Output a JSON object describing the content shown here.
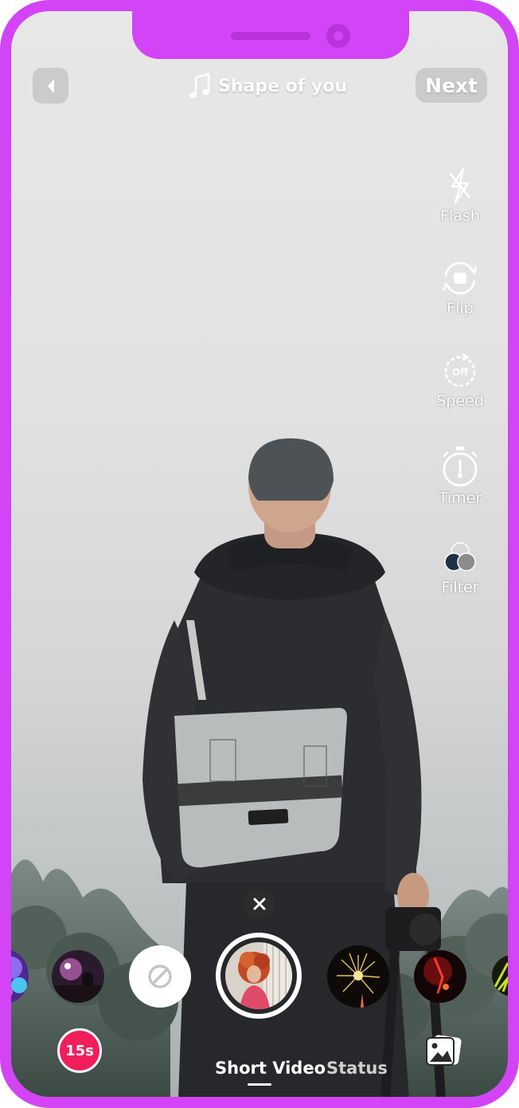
{
  "header": {
    "song_title": "Shape of you",
    "next_label": "Next"
  },
  "tools": [
    {
      "label": "Flash",
      "icon": "flash-off-icon"
    },
    {
      "label": "Flip",
      "icon": "flip-camera-icon"
    },
    {
      "label": "Speed",
      "icon": "speed-icon",
      "icon_text": "Off"
    },
    {
      "label": "Timer",
      "icon": "timer-icon"
    },
    {
      "label": "Filter",
      "icon": "filter-icon"
    }
  ],
  "bottom": {
    "duration": "15s",
    "modes": [
      {
        "label": "Short Video",
        "active": true
      },
      {
        "label": "Status",
        "active": false
      }
    ]
  },
  "colors": {
    "frame": "#d244f5",
    "duration_badge": "#f01e5a"
  }
}
